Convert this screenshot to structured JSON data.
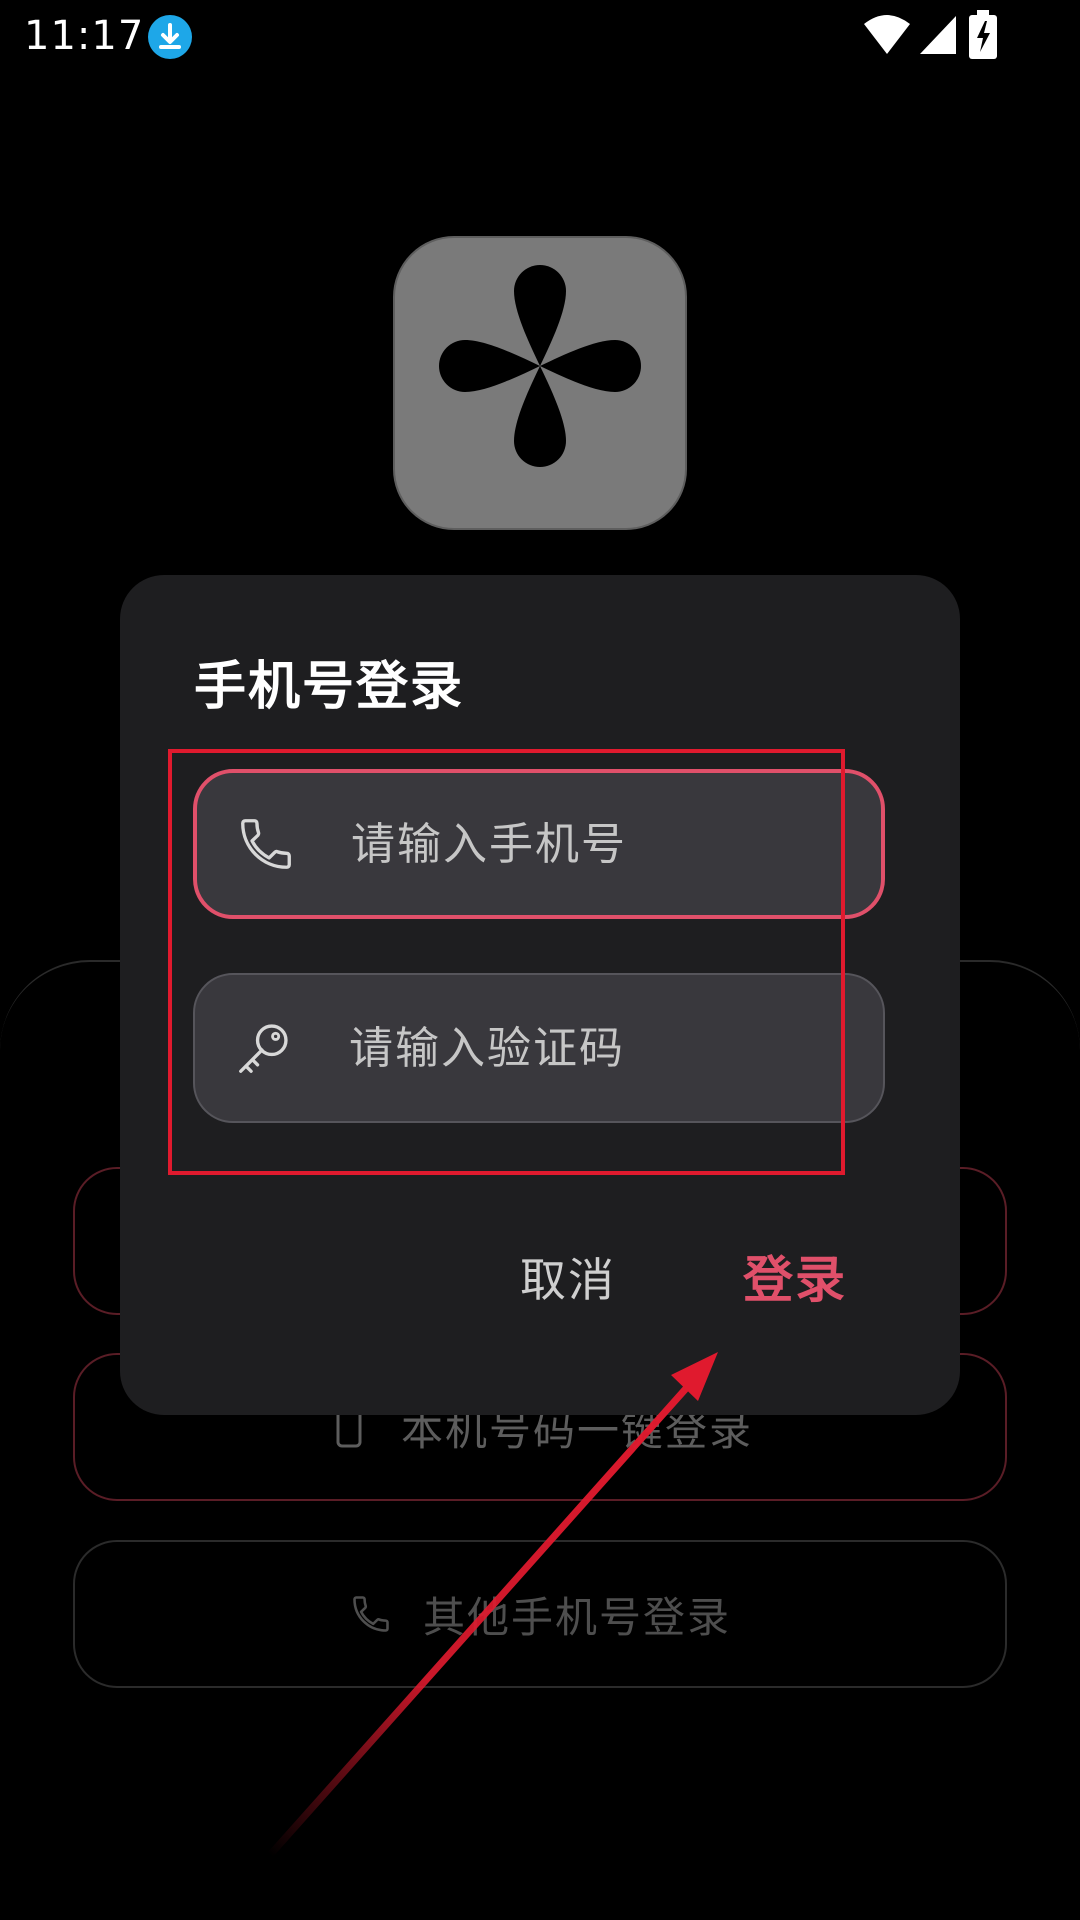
{
  "status_bar": {
    "time": "11:17",
    "download_icon": "download-arrow-circle-icon",
    "wifi_icon": "wifi-icon",
    "signal_icon": "cellular-signal-icon",
    "battery_icon": "battery-charging-icon"
  },
  "app": {
    "logo_icon": "four-petal-logo-icon"
  },
  "background_page": {
    "one_tap_login_label": "本机号码一键登录",
    "other_phone_login_label": "其他手机号登录",
    "one_tap_icon": "smartphone-icon",
    "other_phone_icon": "phone-handset-icon"
  },
  "dialog": {
    "title": "手机号登录",
    "phone_field": {
      "placeholder": "请输入手机号",
      "value": "",
      "icon": "phone-handset-icon"
    },
    "code_field": {
      "placeholder": "请输入验证码",
      "value": "",
      "icon": "key-icon"
    },
    "cancel_label": "取消",
    "login_label": "登录"
  },
  "colors": {
    "background": "#000000",
    "dialog_bg": "#1e1e20",
    "field_bg": "#39383d",
    "accent": "#e0506a",
    "annotation": "#e01a2e",
    "download_badge": "#1ea7e8",
    "logo_bg": "#7a7a7a"
  }
}
